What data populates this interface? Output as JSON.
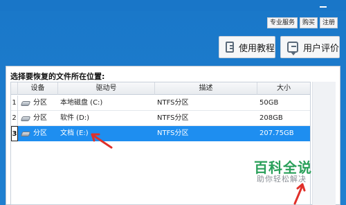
{
  "top_links": [
    "专业服务",
    "购买",
    "注册"
  ],
  "buttons": {
    "guide": "使用教程",
    "review": "用户评价"
  },
  "prompt": "选择要恢复的文件所在位置:",
  "table": {
    "headers": [
      "",
      "设备",
      "驱动号",
      "描述",
      "大小"
    ],
    "rows": [
      {
        "num": "1",
        "device": "分区",
        "drive": "本地磁盘 (C:)",
        "desc": "NTFS分区",
        "size": "50GB"
      },
      {
        "num": "2",
        "device": "分区",
        "drive": "软件 (D:)",
        "desc": "NTFS分区",
        "size": "208GB"
      },
      {
        "num": "3",
        "device": "分区",
        "drive": "文档 (E:)",
        "desc": "NTFS分区",
        "size": "207.75GB"
      }
    ]
  },
  "watermark": {
    "title": "百科全说",
    "subtitle": "助你轻松解决"
  },
  "colors": {
    "accent": "#1976c8",
    "selected_row": "#1e8ef0",
    "arrow": "#e0302a",
    "watermark": "#2aa05a"
  },
  "icons": {
    "minimize": "minimize-icon",
    "guide": "book-icon",
    "review": "chat-icon",
    "disk": "disk-icon"
  }
}
